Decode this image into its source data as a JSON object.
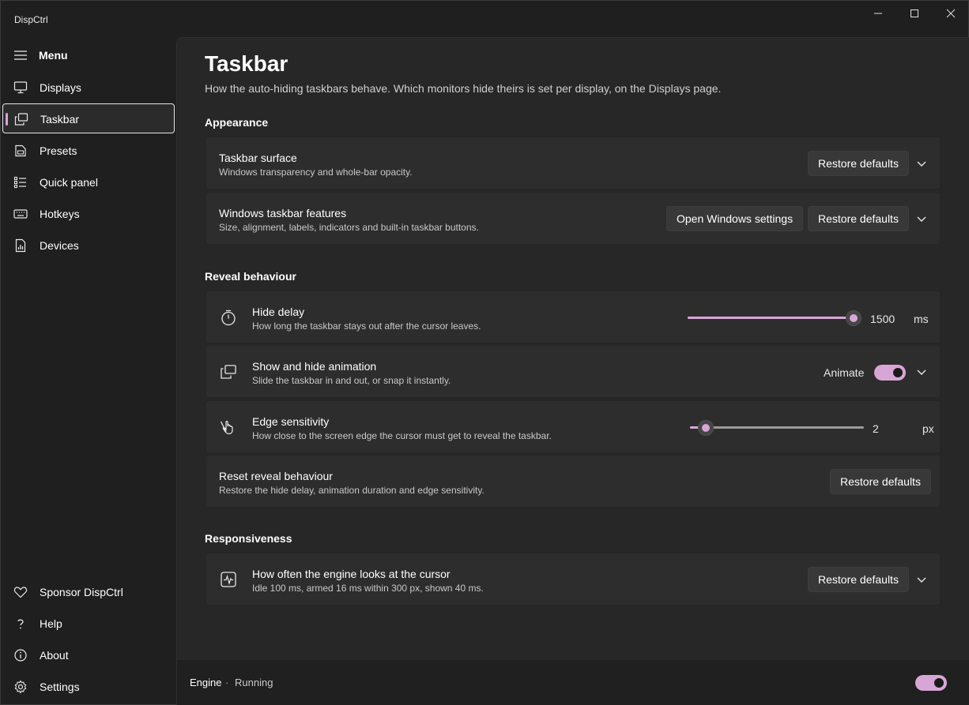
{
  "app": {
    "title": "DispCtrl"
  },
  "sidebar": {
    "menu_label": "Menu",
    "items": [
      {
        "label": "Displays",
        "icon": "monitor-icon"
      },
      {
        "label": "Taskbar",
        "icon": "windows-icon",
        "selected": true
      },
      {
        "label": "Presets",
        "icon": "document-icon"
      },
      {
        "label": "Quick panel",
        "icon": "list-icon"
      },
      {
        "label": "Hotkeys",
        "icon": "keyboard-icon"
      },
      {
        "label": "Devices",
        "icon": "device-report-icon"
      }
    ],
    "footer_items": [
      {
        "label": "Sponsor DispCtrl",
        "icon": "heart-icon"
      },
      {
        "label": "Help",
        "icon": "question-icon"
      },
      {
        "label": "About",
        "icon": "info-icon"
      },
      {
        "label": "Settings",
        "icon": "gear-icon"
      }
    ]
  },
  "page": {
    "title": "Taskbar",
    "description": "How the auto-hiding taskbars behave. Which monitors hide theirs is set per display, on the Displays page."
  },
  "appearance": {
    "heading": "Appearance",
    "surface": {
      "title": "Taskbar surface",
      "subtitle": "Windows transparency and whole-bar opacity.",
      "restore_label": "Restore defaults"
    },
    "features": {
      "title": "Windows taskbar features",
      "subtitle": "Size, alignment, labels, indicators and built-in taskbar buttons.",
      "open_settings_label": "Open Windows settings",
      "restore_label": "Restore defaults"
    }
  },
  "reveal": {
    "heading": "Reveal behaviour",
    "hide_delay": {
      "title": "Hide delay",
      "subtitle": "How long the taskbar stays out after the cursor leaves.",
      "value": "1500",
      "unit": "ms",
      "fraction": 1.0
    },
    "animation": {
      "title": "Show and hide animation",
      "subtitle": "Slide the taskbar in and out, or snap it instantly.",
      "toggle_label": "Animate",
      "on": true
    },
    "edge": {
      "title": "Edge sensitivity",
      "subtitle": "How close to the screen edge the cursor must get to reveal the taskbar.",
      "value": "2",
      "unit": "px",
      "fraction": 0.05
    },
    "reset": {
      "title": "Reset reveal behaviour",
      "subtitle": "Restore the hide delay, animation duration and edge sensitivity.",
      "restore_label": "Restore defaults"
    }
  },
  "responsiveness": {
    "heading": "Responsiveness",
    "engine": {
      "title": "How often the engine looks at the cursor",
      "subtitle": "Idle 100 ms, armed 16 ms within 300 px, shown 40 ms.",
      "restore_label": "Restore defaults"
    }
  },
  "footer": {
    "engine_label": "Engine",
    "separator": "·",
    "status": "Running",
    "engine_on": true
  },
  "colors": {
    "accent": "#d8a6d6",
    "card": "#2d2d2d",
    "content_bg": "#272727"
  }
}
